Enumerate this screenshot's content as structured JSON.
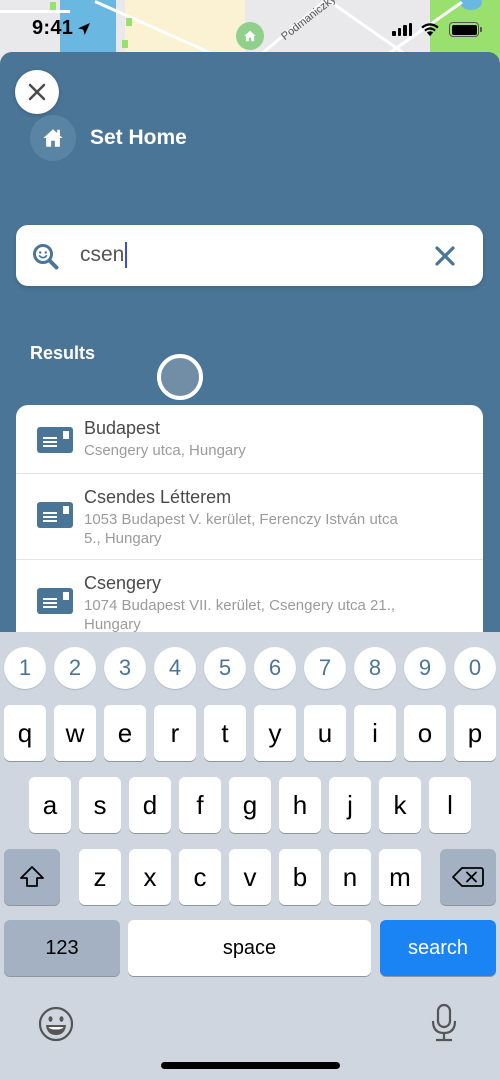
{
  "status_bar": {
    "time": "9:41"
  },
  "map": {
    "street_label": "Podmaniczky"
  },
  "sheet": {
    "title": "Set Home",
    "close_icon": "close-icon",
    "home_icon": "home-icon"
  },
  "search": {
    "value": "csen",
    "icon": "search-icon",
    "clear_icon": "clear-icon"
  },
  "results": {
    "label": "Results",
    "items": [
      {
        "title": "Budapest",
        "subtitle": "Csengery utca, Hungary",
        "icon": "address-card-icon"
      },
      {
        "title": "Csendes Létterem",
        "subtitle": "1053 Budapest V. kerület, Ferenczy István utca 5., Hungary",
        "icon": "address-card-icon"
      },
      {
        "title": "Csengery",
        "subtitle": "1074 Budapest VII. kerület, Csengery utca 21., Hungary",
        "icon": "address-card-icon"
      }
    ]
  },
  "keyboard": {
    "numbers": [
      "1",
      "2",
      "3",
      "4",
      "5",
      "6",
      "7",
      "8",
      "9",
      "0"
    ],
    "row1": [
      "q",
      "w",
      "e",
      "r",
      "t",
      "y",
      "u",
      "i",
      "o",
      "p"
    ],
    "row2": [
      "a",
      "s",
      "d",
      "f",
      "g",
      "h",
      "j",
      "k",
      "l"
    ],
    "row3": [
      "z",
      "x",
      "c",
      "v",
      "b",
      "n",
      "m"
    ],
    "numbers_switch": "123",
    "space": "space",
    "search": "search"
  },
  "colors": {
    "sheet_bg": "#4a7596",
    "search_key": "#1a84f4",
    "accent": "#4a7596"
  }
}
